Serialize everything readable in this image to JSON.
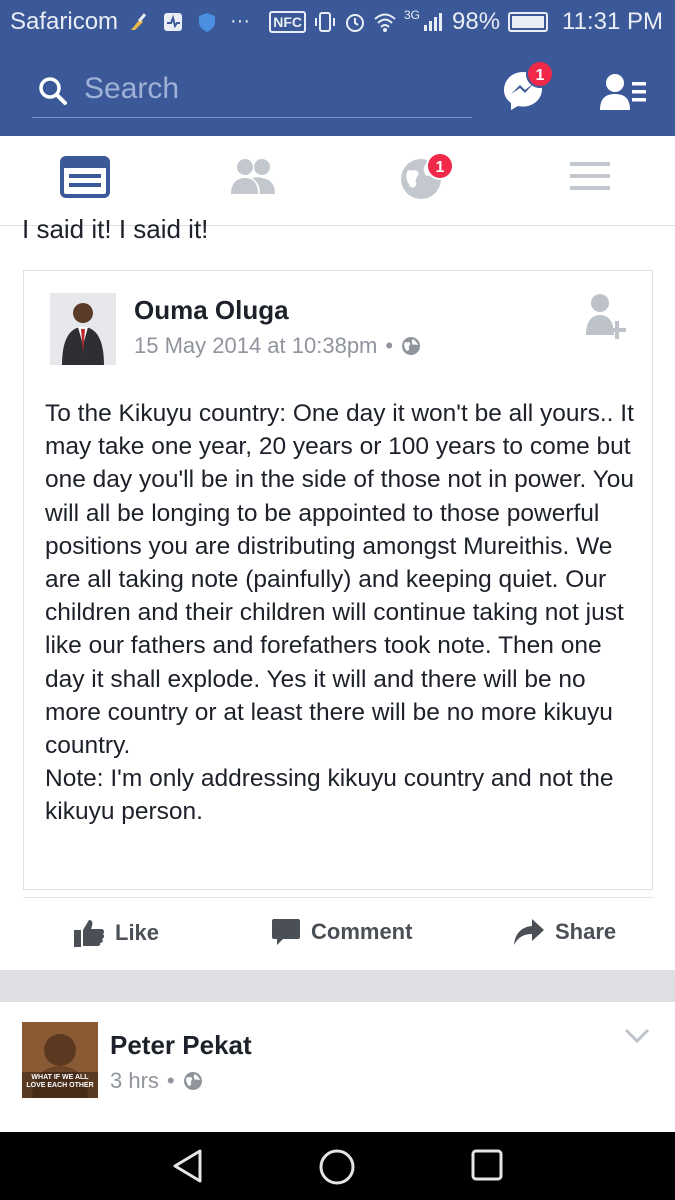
{
  "status": {
    "carrier": "Safaricom",
    "nfc": "NFC",
    "network": "3G",
    "battery": "98%",
    "time": "11:31 PM"
  },
  "appbar": {
    "search_placeholder": "Search",
    "messenger_badge": "1"
  },
  "tabs": {
    "notifications_badge": "1"
  },
  "feed": {
    "previous_text": "I said it! I said it!",
    "shared_post": {
      "author": "Ouma Oluga",
      "timestamp": "15 May 2014 at 10:38pm",
      "dot": "•",
      "text": "To the Kikuyu country: One day it won't be all yours.. It may take one year, 20 years or 100 years to come but one day you'll be in the side of those not in power. You will all be longing to be appointed to those powerful positions you are distributing amongst Mureithis. We are all taking note (painfully) and keeping quiet. Our children and their children will continue taking not just like our fathers and forefathers took note. Then one day it shall explode. Yes it will and there will be no more country or at least there will be no more kikuyu country.\nNote: I'm only addressing kikuyu country and not the kikuyu person."
    },
    "actions": {
      "like": "Like",
      "comment": "Comment",
      "share": "Share"
    },
    "next_post": {
      "author": "Peter Pekat",
      "timestamp": "3 hrs",
      "dot": "•",
      "avatar_caption": "WHAT IF WE ALL LOVE EACH OTHER"
    }
  },
  "colors": {
    "brand": "#3b5998",
    "badge": "#f02849"
  }
}
